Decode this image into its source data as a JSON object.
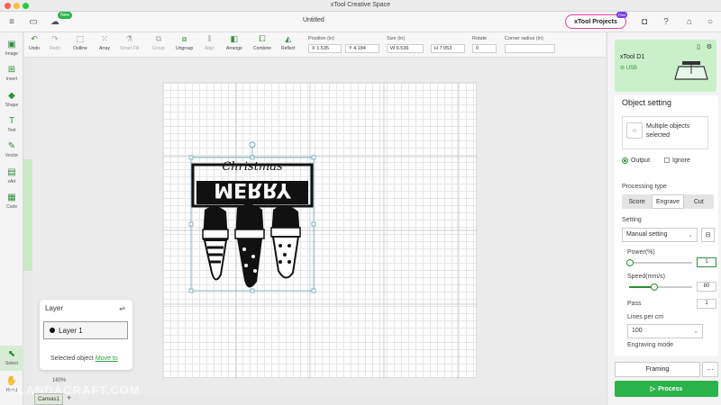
{
  "window": {
    "title": "xTool Creative Space"
  },
  "header": {
    "new_badge": "New",
    "doc_title": "Untitled",
    "projects_label": "xTool Projects",
    "free_badge": "Free"
  },
  "rail": {
    "items": [
      {
        "label": "Image",
        "icon": "image-icon"
      },
      {
        "label": "Insert",
        "icon": "insert-icon"
      },
      {
        "label": "Shape",
        "icon": "shape-icon"
      },
      {
        "label": "Text",
        "icon": "text-icon"
      },
      {
        "label": "Vector",
        "icon": "pen-icon"
      },
      {
        "label": "xArt",
        "icon": "xart-icon"
      },
      {
        "label": "Code",
        "icon": "code-icon"
      },
      {
        "label": "Select",
        "icon": "select-icon"
      },
      {
        "label": "Hand",
        "icon": "hand-icon"
      }
    ]
  },
  "toolbar": {
    "undo": "Undo",
    "redo": "Redo",
    "outline": "Outline",
    "array": "Array",
    "smartfill": "Smart Fill",
    "group": "Group",
    "ungroup": "Ungroup",
    "align": "Align",
    "arrange": "Arrange",
    "combine": "Combine",
    "reflect": "Reflect",
    "position_label": "Position (in)",
    "x_value": "X 1.535",
    "y_value": "Y 4.184",
    "size_label": "Size (in)",
    "w_value": "W 6.536",
    "h_value": "H 7.053",
    "rotate_label": "Rotate",
    "rotate_value": "0",
    "corner_label": "Corner radius (in)"
  },
  "artwork": {
    "script_text": "Christmas",
    "block_text": "MERRY"
  },
  "layer_panel": {
    "title": "Layer",
    "layer_name": "Layer 1",
    "selected_text": "Selected object",
    "move_to": "Move to"
  },
  "canvas": {
    "zoom": "160%",
    "tab": "Canvas1",
    "add_tab": "+",
    "watermark": "PLANDACRAFT.COM"
  },
  "device": {
    "name": "xTool D1",
    "connection": "USB"
  },
  "object_setting": {
    "title": "Object setting",
    "multi_line1": "Multiple objects",
    "multi_line2": "selected",
    "output": "Output",
    "ignore": "Ignore",
    "processing_type": "Processing type",
    "types": [
      "Score",
      "Engrave",
      "Cut"
    ],
    "active_type": "Engrave",
    "setting_label": "Setting",
    "setting_value": "Manual setting",
    "power_label": "Power(%)",
    "power_value": "1",
    "power_level": 0.01,
    "speed_label": "Speed(mm/s)",
    "speed_value": "80",
    "speed_level": 0.4,
    "pass_label": "Pass",
    "pass_value": "1",
    "lines_label": "Lines per cm",
    "lines_value": "100",
    "engraving_mode": "Engraving mode"
  },
  "actions": {
    "framing": "Framing",
    "more": "···",
    "process": "Process"
  },
  "colors": {
    "accent": "#2bb34b",
    "device_bg": "#caf0c9",
    "projects_border": "#e0409a"
  }
}
